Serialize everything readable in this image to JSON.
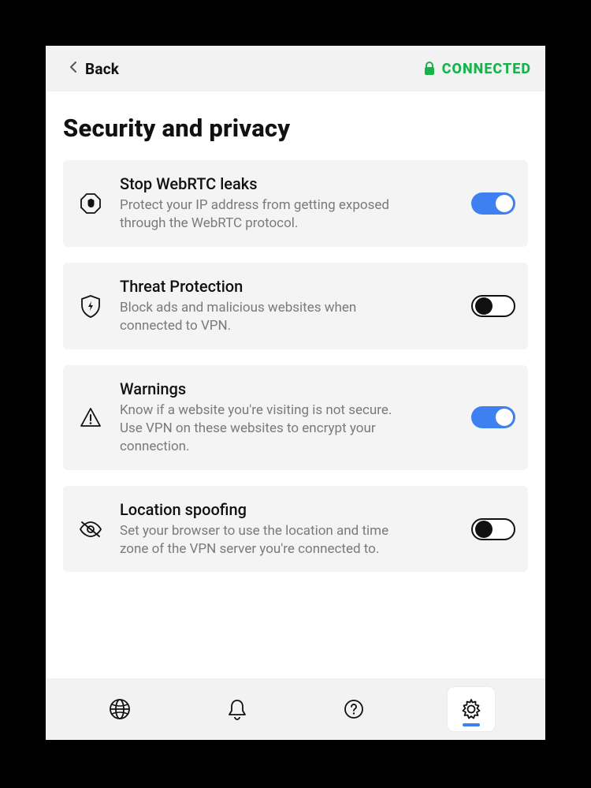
{
  "header": {
    "back_label": "Back",
    "status_text": "CONNECTED"
  },
  "page": {
    "title": "Security and privacy"
  },
  "settings": {
    "items": [
      {
        "icon": "stop-hand-icon",
        "title": "Stop WebRTC leaks",
        "desc": "Protect your IP address from getting exposed through the WebRTC protocol.",
        "enabled": true
      },
      {
        "icon": "shield-bolt-icon",
        "title": "Threat Protection",
        "desc": "Block ads and malicious websites when connected to VPN.",
        "enabled": false
      },
      {
        "icon": "warning-triangle-icon",
        "title": "Warnings",
        "desc": "Know if a website you're visiting is not secure. Use VPN on these websites to encrypt your connection.",
        "enabled": true
      },
      {
        "icon": "eye-off-icon",
        "title": "Location spoofing",
        "desc": "Set your browser to use the location and time zone of the VPN server you're connected to.",
        "enabled": false
      }
    ]
  },
  "tabs": {
    "items": [
      {
        "name": "globe-tab",
        "icon": "globe-icon",
        "active": false
      },
      {
        "name": "alerts-tab",
        "icon": "bell-icon",
        "active": false
      },
      {
        "name": "help-tab",
        "icon": "help-icon",
        "active": false
      },
      {
        "name": "settings-tab",
        "icon": "gear-icon",
        "active": true
      }
    ]
  },
  "colors": {
    "accent_toggle_on": "#3e7ff2",
    "status_green": "#16b24b",
    "card_bg": "#f4f4f4",
    "chrome_bg": "#f2f2f2"
  }
}
